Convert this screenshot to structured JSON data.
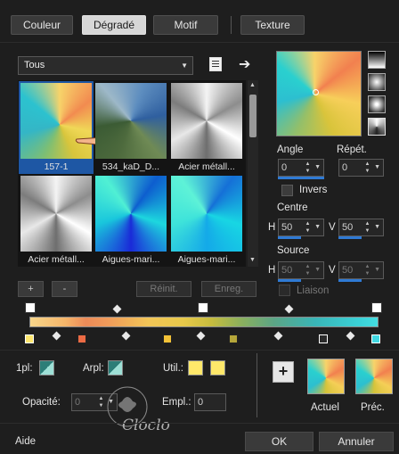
{
  "tabs": [
    "Couleur",
    "Dégradé",
    "Motif",
    "Texture"
  ],
  "active_tab": "Dégradé",
  "category": {
    "value": "Tous"
  },
  "gallery": [
    {
      "caption": "157-1",
      "selected": true
    },
    {
      "caption": "534_kaD_D...",
      "selected": false
    },
    {
      "caption": "Acier métall...",
      "selected": false
    },
    {
      "caption": "Acier métall...",
      "selected": false
    },
    {
      "caption": "Aigues-mari...",
      "selected": false
    },
    {
      "caption": "Aigues-mari...",
      "selected": false
    }
  ],
  "gallery_buttons": {
    "add": "+",
    "remove": "-",
    "reset": "Réinit.",
    "save": "Enreg."
  },
  "angle": {
    "label": "Angle",
    "value": "0"
  },
  "repeat": {
    "label": "Répét.",
    "value": "0"
  },
  "invert": {
    "label": "Invers",
    "checked": false
  },
  "center": {
    "label": "Centre",
    "h_label": "H",
    "h": "50",
    "v_label": "V",
    "v": "50"
  },
  "source": {
    "label": "Source",
    "h_label": "H",
    "h": "50",
    "v_label": "V",
    "v": "50"
  },
  "link": {
    "label": "Liaison",
    "checked": false
  },
  "stops_left": {
    "first": {
      "label": "1pl:"
    },
    "style": {
      "label": "Arpl:"
    },
    "util": {
      "label": "Util.:",
      "colors": [
        "#ffe86a",
        "#ffe86a"
      ]
    },
    "opacity": {
      "label": "Opacité:",
      "value": "0"
    },
    "location": {
      "label": "Empl.:",
      "value": "0"
    }
  },
  "swatch_labels": {
    "current": "Actuel",
    "previous": "Préc."
  },
  "add_swatch": "+",
  "footer": {
    "help": "Aide",
    "ok": "OK",
    "cancel": "Annuler"
  },
  "watermark": "Cloclo",
  "colors": {
    "accent": "#2f7ad4",
    "bg": "#1e1e1e"
  }
}
